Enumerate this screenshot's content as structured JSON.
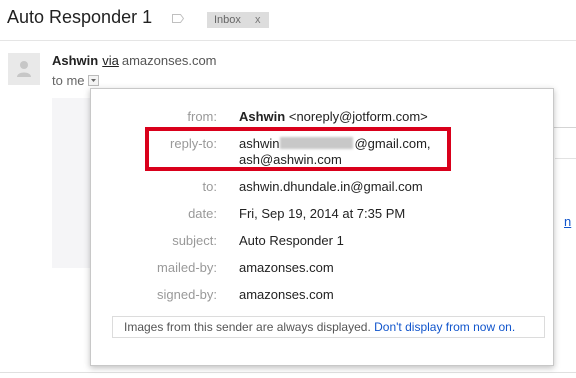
{
  "subject": {
    "title": "Auto Responder 1",
    "label_chip": "Inbox",
    "label_remove": "x"
  },
  "message": {
    "sender_name": "Ashwin",
    "via_text": "via",
    "via_domain": "amazonses.com",
    "to_text": "to me"
  },
  "details": {
    "from": {
      "label": "from:",
      "name": "Ashwin",
      "email": "<noreply@jotform.com>"
    },
    "reply_to": {
      "label": "reply-to:",
      "line1_prefix": "ashwin",
      "line1_suffix": "@gmail.com,",
      "line2": "ash@ashwin.com"
    },
    "to": {
      "label": "to:",
      "value": "ashwin.dhundale.in@gmail.com"
    },
    "date": {
      "label": "date:",
      "value": "Fri, Sep 19, 2014 at 7:35 PM"
    },
    "subject": {
      "label": "subject:",
      "value": "Auto Responder 1"
    },
    "mailed_by": {
      "label": "mailed-by:",
      "value": "amazonses.com"
    },
    "signed_by": {
      "label": "signed-by:",
      "value": "amazonses.com"
    }
  },
  "images_notice": {
    "text": "Images from this sender are always displayed.",
    "link": "Don't display from now on."
  },
  "colors": {
    "highlight_border": "#d9001b",
    "link": "#1155cc",
    "label_gray": "#999999"
  }
}
